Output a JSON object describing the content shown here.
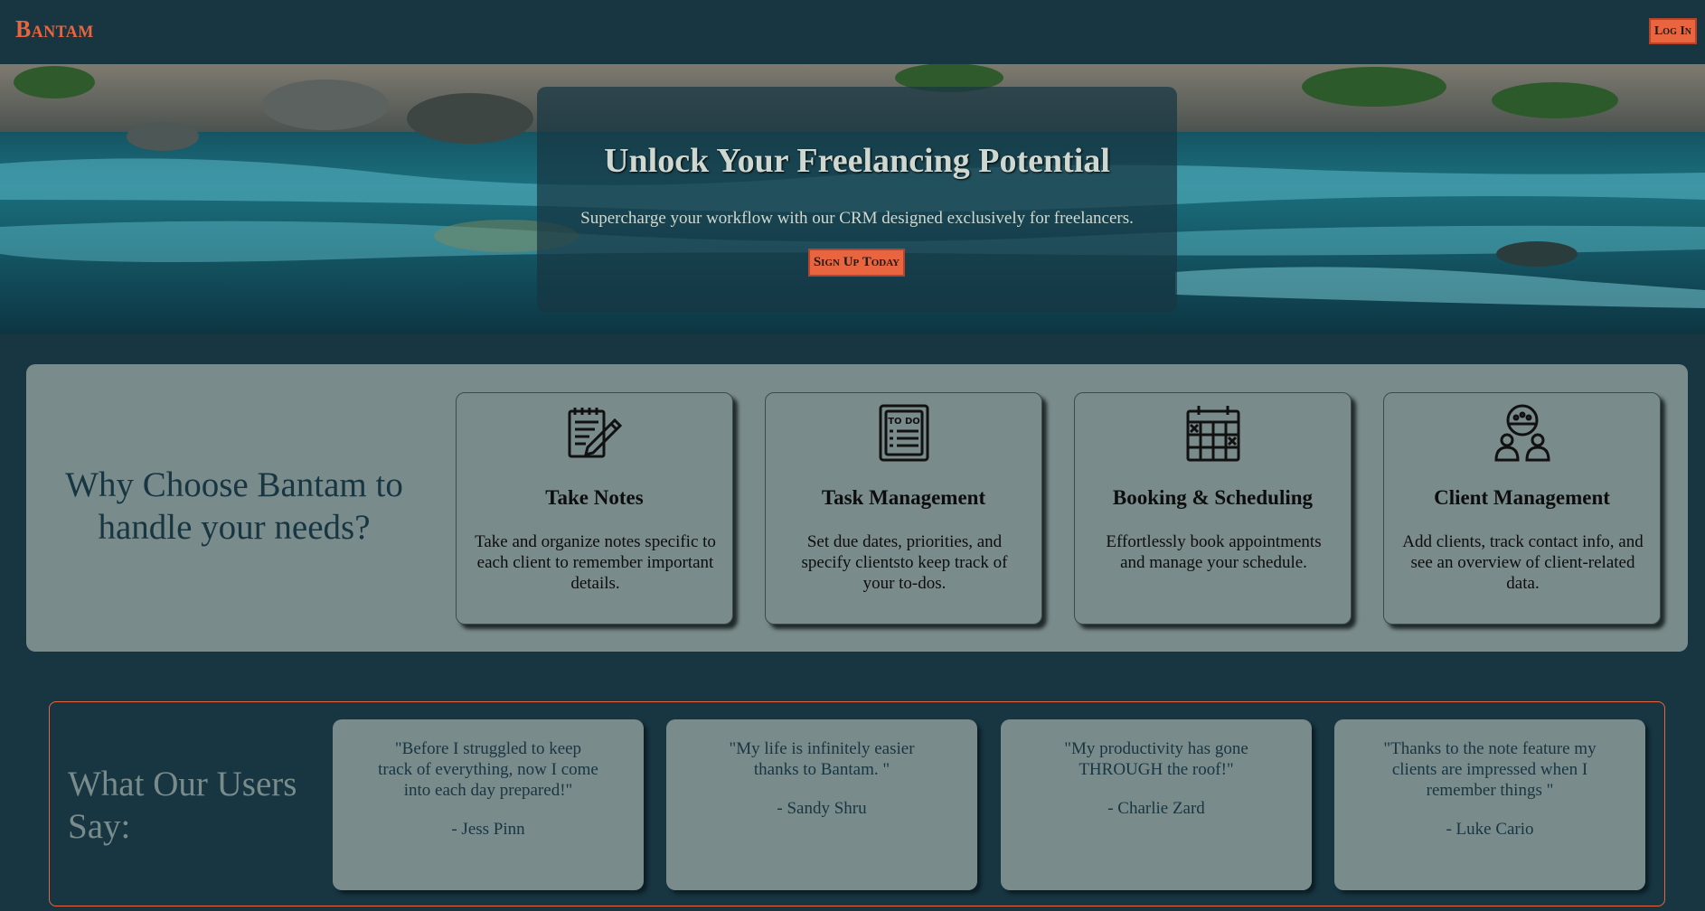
{
  "header": {
    "brand": "Bantam",
    "login_label": "Log In"
  },
  "hero": {
    "title": "Unlock Your Freelancing Potential",
    "subtitle": "Supercharge your workflow with our CRM designed exclusively for freelancers.",
    "cta_label": "Sign Up Today"
  },
  "features": {
    "heading": "Why Choose Bantam to handle your needs?",
    "cards": [
      {
        "icon": "notepad-pencil-icon",
        "title": "Take Notes",
        "description": "Take and organize notes specific to each client to remember important details."
      },
      {
        "icon": "todo-list-icon",
        "title": "Task Management",
        "description": "Set due dates, priorities, and specify clientsto keep track of your to-dos."
      },
      {
        "icon": "calendar-icon",
        "title": "Booking & Scheduling",
        "description": "Effortlessly book appointments and manage your schedule."
      },
      {
        "icon": "client-group-icon",
        "title": "Client Management",
        "description": "Add clients, track contact info, and see an overview of client-related data."
      }
    ]
  },
  "testimonials": {
    "heading": "What Our Users Say:",
    "items": [
      {
        "quote": "\"Before I struggled to keep track of everything, now I come into each day prepared!\"",
        "author": "- Jess Pinn"
      },
      {
        "quote": "\"My life is infinitely easier thanks to Bantam. \"",
        "author": "- Sandy Shru"
      },
      {
        "quote": "\"My productivity has gone THROUGH the roof!\"",
        "author": "- Charlie Zard"
      },
      {
        "quote": "\"Thanks to the note feature my clients are impressed when I remember things \"",
        "author": "- Luke Cario"
      }
    ]
  },
  "colors": {
    "background": "#173642",
    "accent": "#e8653f",
    "card": "#7a8b8b"
  }
}
